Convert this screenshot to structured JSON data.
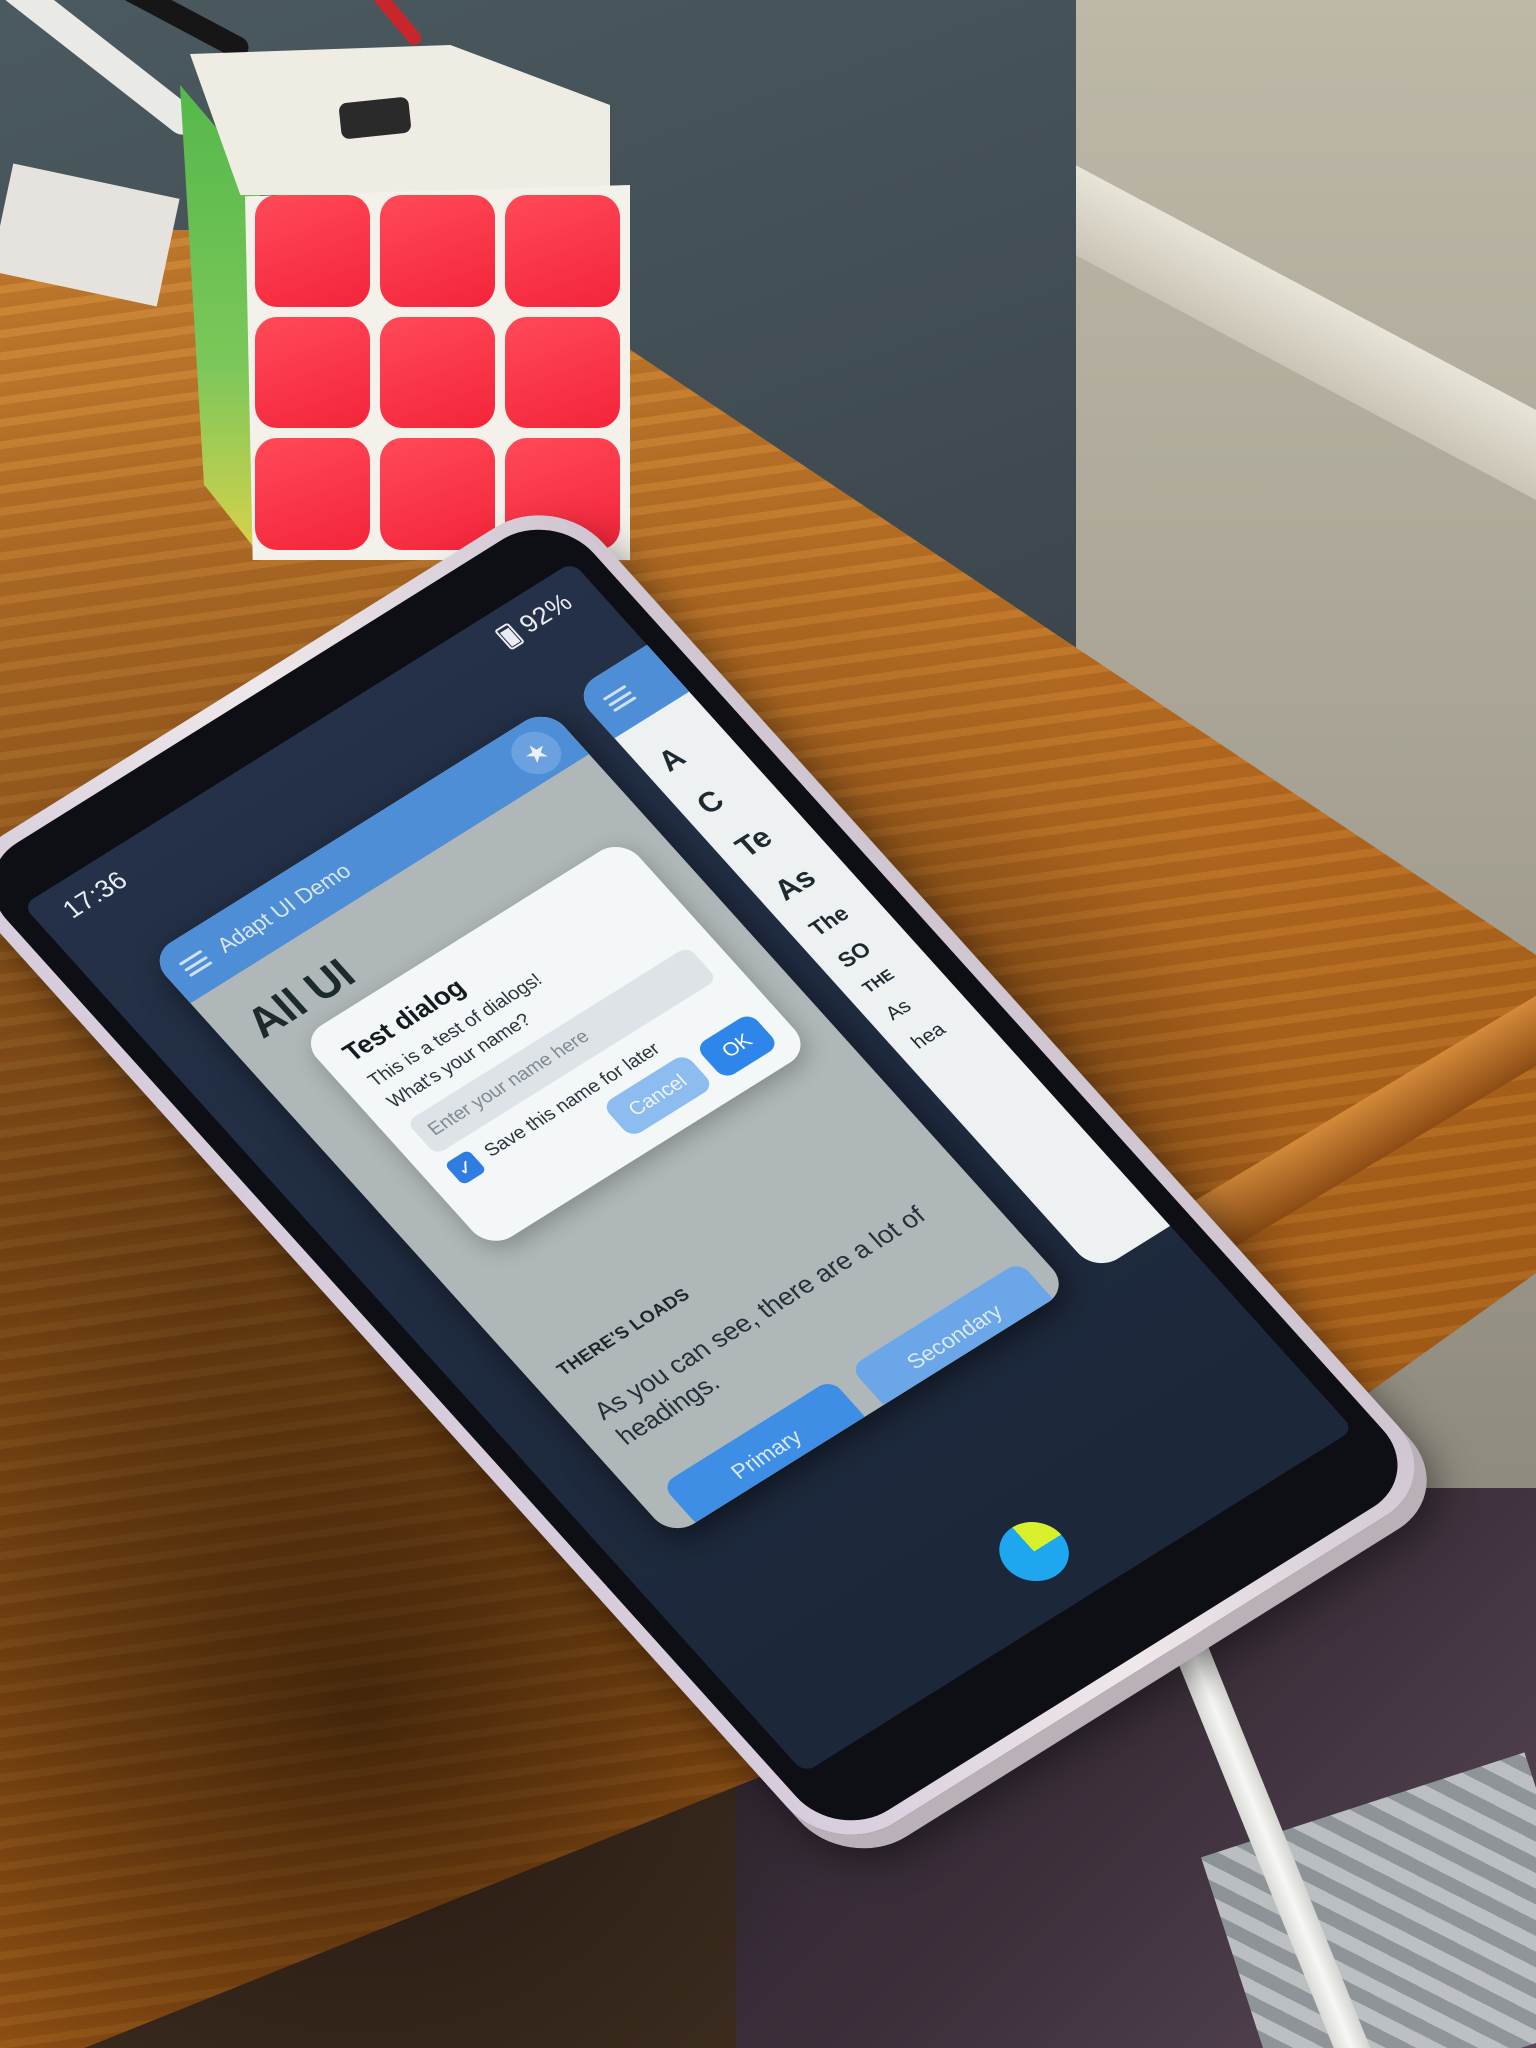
{
  "status_bar": {
    "time": "17:36",
    "battery": "92%",
    "battery_icon": "battery-charging-icon"
  },
  "app": {
    "title": "Adapt UI Demo",
    "menu_icon": "menu-icon",
    "fab_icon": "star-icon",
    "page_title": "All UI",
    "section_heading": "THERE'S LOADS",
    "section_body": "As you can see, there are a lot of headings.",
    "buttons": [
      "Primary",
      "Secondary"
    ]
  },
  "dialog": {
    "title": "Test dialog",
    "message": "This is a test of dialogs!",
    "prompt": "What's your name?",
    "input_value": "",
    "input_placeholder": "Enter your name here",
    "checkbox_label": "Save this name for later",
    "checkbox_checked": true,
    "cancel_label": "Cancel",
    "ok_label": "OK"
  },
  "second_card": {
    "peek_lines": [
      "A",
      "C",
      "Te",
      "As",
      "The",
      "SO",
      "THE",
      "As",
      "hea"
    ]
  },
  "colors": {
    "accent": "#2f86ea",
    "app_bar": "#4d8ed6",
    "home_pill_primary": "#1ea7ef",
    "home_pill_secondary": "#d8ef2c"
  }
}
